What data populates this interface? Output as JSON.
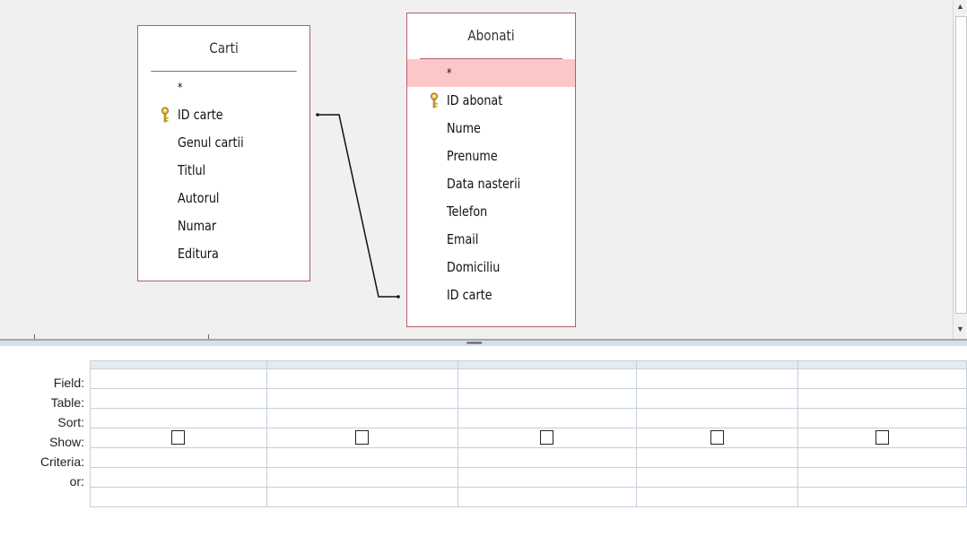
{
  "tables": {
    "carti": {
      "title": "Carti",
      "fields": [
        "*",
        "ID carte",
        "Genul cartii",
        "Titlul",
        "Autorul",
        "Numar",
        "Editura"
      ]
    },
    "abonati": {
      "title": "Abonati",
      "fields": [
        "*",
        "ID abonat",
        "Nume",
        "Prenume",
        "Data nasterii",
        "Telefon",
        "Email",
        "Domiciliu",
        "ID carte"
      ]
    }
  },
  "grid": {
    "row_labels": [
      "Field:",
      "Table:",
      "Sort:",
      "Show:",
      "Criteria:",
      "or:"
    ],
    "column_count": 5
  },
  "colors": {
    "table_border": "#b55e66",
    "selected_row": "#fcc7c9",
    "design_background": "#f0f0f0",
    "grid_lines": "#c6cfdb"
  },
  "icons": {
    "primary_key": "key-icon",
    "join_line": "relationship-line"
  }
}
